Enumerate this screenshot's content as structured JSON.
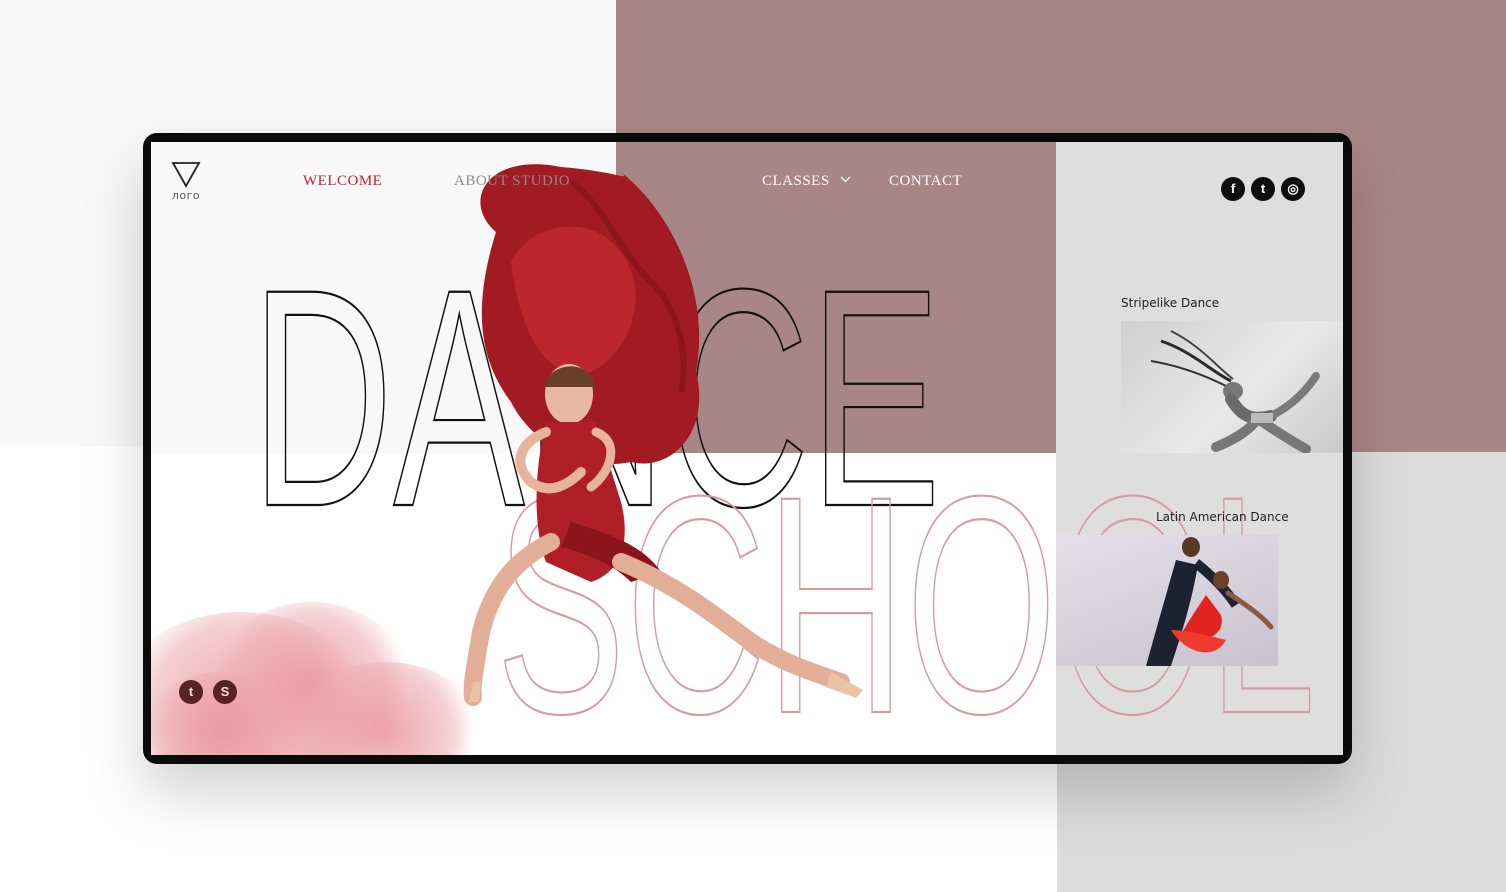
{
  "logo": {
    "text": "лого",
    "icon": "triangle-down-icon"
  },
  "nav": {
    "items": [
      {
        "label": "WELCOME",
        "active": true
      },
      {
        "label": "ABOUT STUDIO",
        "active": false
      },
      {
        "label": "CLASSES",
        "has_dropdown": true
      },
      {
        "label": "CONTACT",
        "active": false
      }
    ]
  },
  "hero": {
    "word_top": "DANCE",
    "word_bottom": "SCHOOL"
  },
  "social_top": [
    {
      "icon": "facebook-icon",
      "glyph": "f"
    },
    {
      "icon": "twitter-icon",
      "glyph": "t"
    },
    {
      "icon": "instagram-icon",
      "glyph": "◎"
    }
  ],
  "social_bottom": [
    {
      "icon": "tumblr-icon",
      "glyph": "t"
    },
    {
      "icon": "skype-icon",
      "glyph": "S"
    }
  ],
  "classes": [
    {
      "title": "Stripelike Dance"
    },
    {
      "title": "Latin American Dance"
    }
  ],
  "colors": {
    "accent_red": "#c71e2a",
    "mauve": "#a88685",
    "pink_letters": "#d59ca0",
    "light_gray": "#dedede"
  }
}
